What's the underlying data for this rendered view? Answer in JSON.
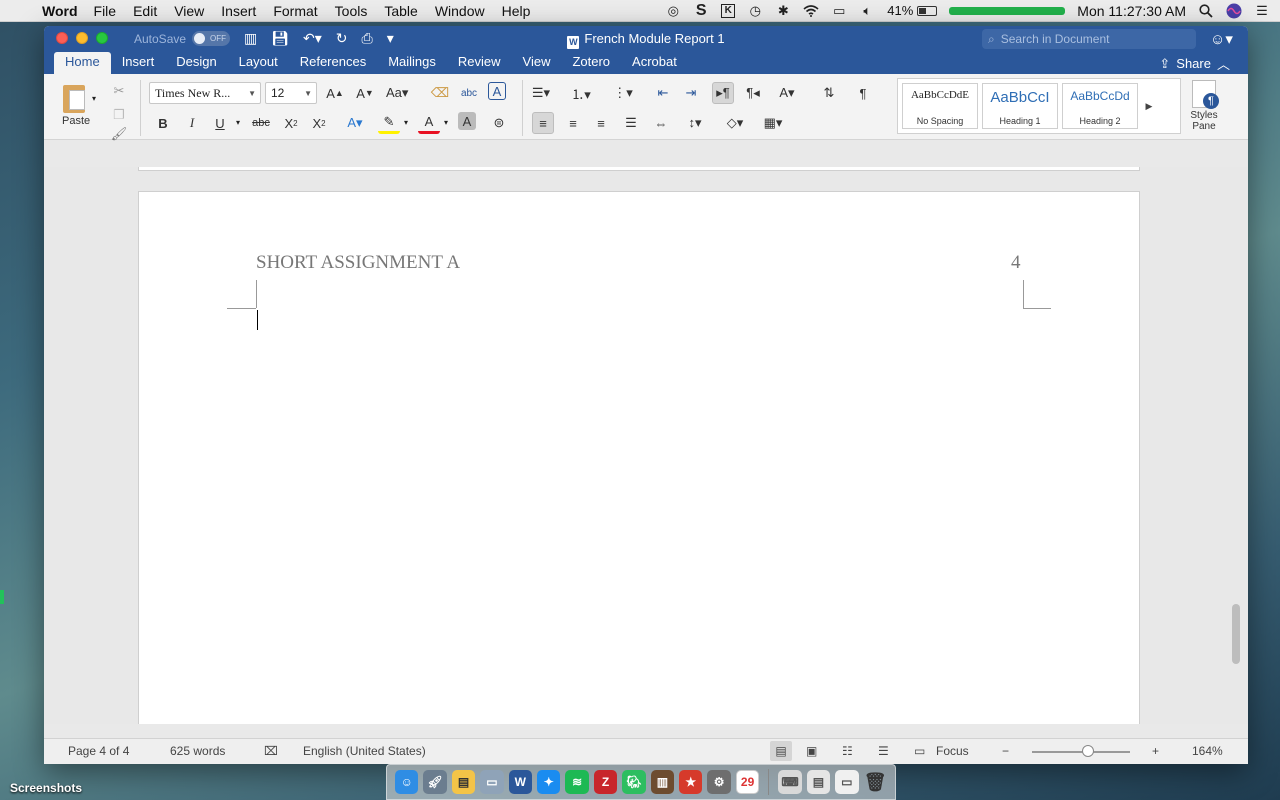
{
  "menubar": {
    "app_name": "Word",
    "items": [
      "File",
      "Edit",
      "View",
      "Insert",
      "Format",
      "Tools",
      "Table",
      "Window",
      "Help"
    ],
    "battery_percent": "41%",
    "clock": "Mon 11:27:30 AM"
  },
  "window": {
    "title": "French Module Report 1",
    "autosave_label": "AutoSave",
    "autosave_state": "OFF",
    "search_placeholder": "Search in Document",
    "share_label": "Share"
  },
  "tabs": [
    "Home",
    "Insert",
    "Design",
    "Layout",
    "References",
    "Mailings",
    "Review",
    "View",
    "Zotero",
    "Acrobat"
  ],
  "ribbon": {
    "paste_label": "Paste",
    "font_name": "Times New R...",
    "font_size": "12",
    "styles": [
      {
        "preview": "AaBbCcDdE",
        "name": "No Spacing"
      },
      {
        "preview": "AaBbCcI",
        "name": "Heading 1"
      },
      {
        "preview": "AaBbCcDd",
        "name": "Heading 2"
      }
    ],
    "styles_pane_label": "Styles Pane"
  },
  "document": {
    "header_text": "SHORT ASSIGNMENT A",
    "page_number": "4"
  },
  "statusbar": {
    "page": "Page 4 of 4",
    "words": "625 words",
    "language": "English (United States)",
    "focus": "Focus",
    "zoom": "164%"
  },
  "desktop": {
    "folder_label": "Screenshots",
    "calendar_day": "29"
  },
  "colors": {
    "word_blue": "#2b579a",
    "font_color_underline": "#e81123",
    "highlight_underline": "#fff200"
  }
}
